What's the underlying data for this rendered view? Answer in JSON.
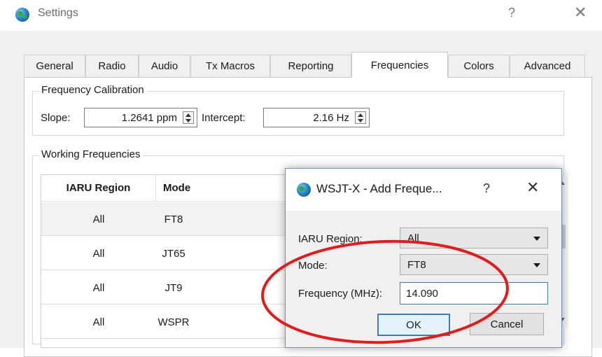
{
  "window": {
    "title": "Settings",
    "help_glyph": "?",
    "close_glyph": "✕"
  },
  "tabs": [
    {
      "label": "General",
      "active": false
    },
    {
      "label": "Radio",
      "active": false
    },
    {
      "label": "Audio",
      "active": false
    },
    {
      "label": "Tx Macros",
      "active": false
    },
    {
      "label": "Reporting",
      "active": false
    },
    {
      "label": "Frequencies",
      "active": true
    },
    {
      "label": "Colors",
      "active": false
    },
    {
      "label": "Advanced",
      "active": false
    }
  ],
  "calibration": {
    "group_title": "Frequency Calibration",
    "slope_label": "Slope:",
    "slope_value": "1.2641 ppm",
    "intercept_label": "Intercept:",
    "intercept_value": "2.16 Hz"
  },
  "working": {
    "group_title": "Working Frequencies",
    "columns": [
      "IARU Region",
      "Mode"
    ],
    "rows": [
      {
        "region": "All",
        "mode": "FT8"
      },
      {
        "region": "All",
        "mode": "JT65"
      },
      {
        "region": "All",
        "mode": "JT9"
      },
      {
        "region": "All",
        "mode": "WSPR"
      }
    ]
  },
  "add_dialog": {
    "title": "WSJT-X - Add Freque...",
    "help_glyph": "?",
    "close_glyph": "✕",
    "region_label": "IARU Region:",
    "region_value": "All",
    "mode_label": "Mode:",
    "mode_value": "FT8",
    "frequency_label": "Frequency (MHz):",
    "frequency_value": "14.090",
    "ok_label": "OK",
    "cancel_label": "Cancel"
  },
  "colors": {
    "annotation": "#e31b1b",
    "focus_border": "#3c7fb1"
  }
}
